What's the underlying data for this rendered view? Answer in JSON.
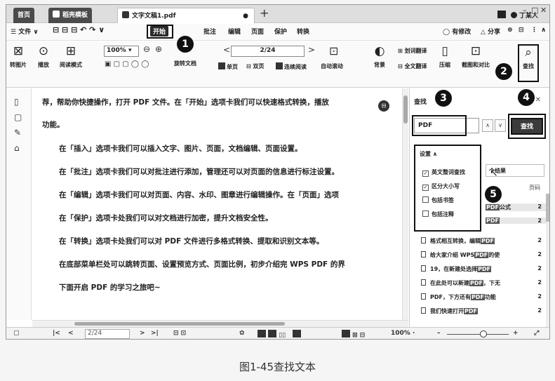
{
  "tabs": [
    {
      "label": "首页",
      "active": false
    },
    {
      "label": "稻壳模板",
      "active": false
    },
    {
      "label": "文字文稿1.pdf",
      "active": true
    }
  ],
  "window": {
    "user": "丁某人",
    "minimize": "–",
    "maximize": "□",
    "close": "✕"
  },
  "menu": {
    "file": "☰ 文件 ∨",
    "start": "开始",
    "items": [
      "批注",
      "编辑",
      "页面",
      "保护",
      "转换"
    ],
    "right": [
      "◯ 有修改",
      "△ 分享",
      "⊕",
      "⊟",
      "⋮",
      "∧"
    ]
  },
  "ribbon": {
    "left_buttons": [
      "转图片",
      "播放",
      "阅读模式"
    ],
    "zoom_value": "100%",
    "rotate": "旋转文档",
    "page_value": "2/24",
    "prev": "<",
    "next": ">",
    "single_page": "单页",
    "double_page": "双页",
    "continuous": "连续阅读",
    "auto_scroll": "自动滚动",
    "background": "背景",
    "translate_word": "划词翻译",
    "translate_all": "全文翻译",
    "compress": "压缩",
    "screenshot": "截图和对比",
    "find": "查找"
  },
  "document": {
    "lines": [
      "荐，帮助你快捷操作，打开 PDF 文件。在「开始」选项卡我们可以快速格式转换，播放",
      "功能。",
      "在「插入」选项卡我们可以插入文字、图片、页面，文档编辑、页面设置。",
      "在「批注」选项卡我们可以对批注进行添加，管理还可以对页面的信息进行标注设置。",
      "在「编辑」选项卡我们可以对页面、内容、水印、图章进行编辑操作。在「页面」选项",
      "在「保护」选项卡处我们可以对文档进行加密，提升文档安全性。",
      "在「转换」选项卡处我们可以对 PDF 文件进行多格式转换、提取和识别文本等。",
      "在底部菜单栏处可以跳转页面、设置预览方式、页面比例，初步介绍完 WPS PDF 的界",
      "下面开启 PDF 的学习之旅吧~"
    ]
  },
  "find_panel": {
    "title": "查找",
    "close": "✕",
    "search_value": "PDF",
    "up": "∧",
    "down": "∨",
    "button": "查找",
    "settings_title": "设置 ∧",
    "options": [
      {
        "label": "英文整词查找",
        "checked": true
      },
      {
        "label": "区分大小写",
        "checked": true
      },
      {
        "label": "包括书签",
        "checked": false
      },
      {
        "label": "包括注释",
        "checked": false
      }
    ],
    "results_header": "个结果",
    "page_label": "页码",
    "results": [
      {
        "pre": "",
        "hit": "PDF",
        "post": "公式",
        "page": "2",
        "selected": true
      },
      {
        "pre": "",
        "hit": "PDF",
        "post": "",
        "page": "2",
        "selected": true
      },
      {
        "pre": "格式相互转换，编辑",
        "hit": "PDF",
        "post": "",
        "page": "2",
        "selected": false
      },
      {
        "pre": "给大家介绍 WPS",
        "hit": "PDF",
        "post": "的使",
        "page": "2",
        "selected": false
      },
      {
        "pre": "19，在新建处选择",
        "hit": "PDF",
        "post": "",
        "page": "2",
        "selected": false
      },
      {
        "pre": "在此处可以新建",
        "hit": "PDF",
        "post": "，下无",
        "page": "2",
        "selected": false
      },
      {
        "pre": "PDF，下方还有",
        "hit": "PDF",
        "post": "功能",
        "page": "2",
        "selected": false
      },
      {
        "pre": "我们快速打开",
        "hit": "PDF",
        "post": "",
        "page": "2",
        "selected": false
      }
    ]
  },
  "status": {
    "first": "|<",
    "prev": "<",
    "page": "2/24",
    "next": ">",
    "last": ">|",
    "zoom": "100% ∙",
    "minus": "–",
    "plus": "+",
    "fit": "⤢"
  },
  "callouts": [
    "1",
    "2",
    "3",
    "4",
    "5"
  ],
  "caption": "图1-45查找文本"
}
